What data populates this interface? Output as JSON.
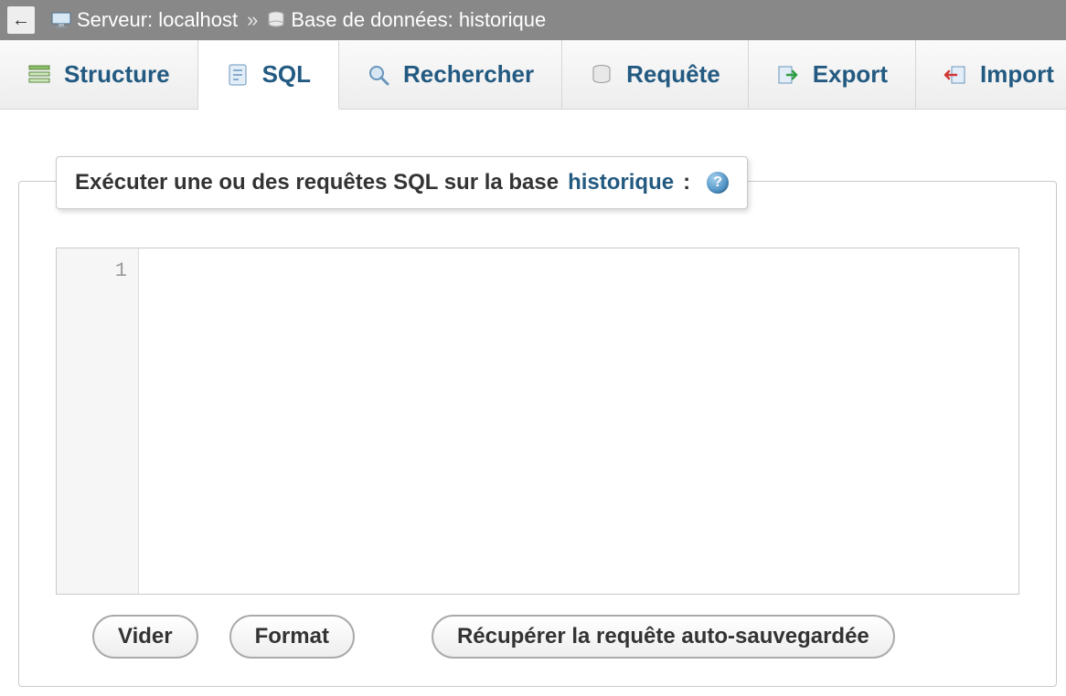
{
  "breadcrumb": {
    "server_label": "Serveur: localhost",
    "separator": "»",
    "db_label": "Base de données: historique"
  },
  "tabs": {
    "structure": "Structure",
    "sql": "SQL",
    "search": "Rechercher",
    "query": "Requête",
    "export": "Export",
    "import": "Import"
  },
  "legend": {
    "prefix": "Exécuter une ou des requêtes SQL sur la base ",
    "db_name": "historique",
    "suffix": ":"
  },
  "editor": {
    "line_number": "1",
    "content": ""
  },
  "buttons": {
    "clear": "Vider",
    "format": "Format",
    "recover": "Récupérer la requête auto-sauvegardée"
  }
}
